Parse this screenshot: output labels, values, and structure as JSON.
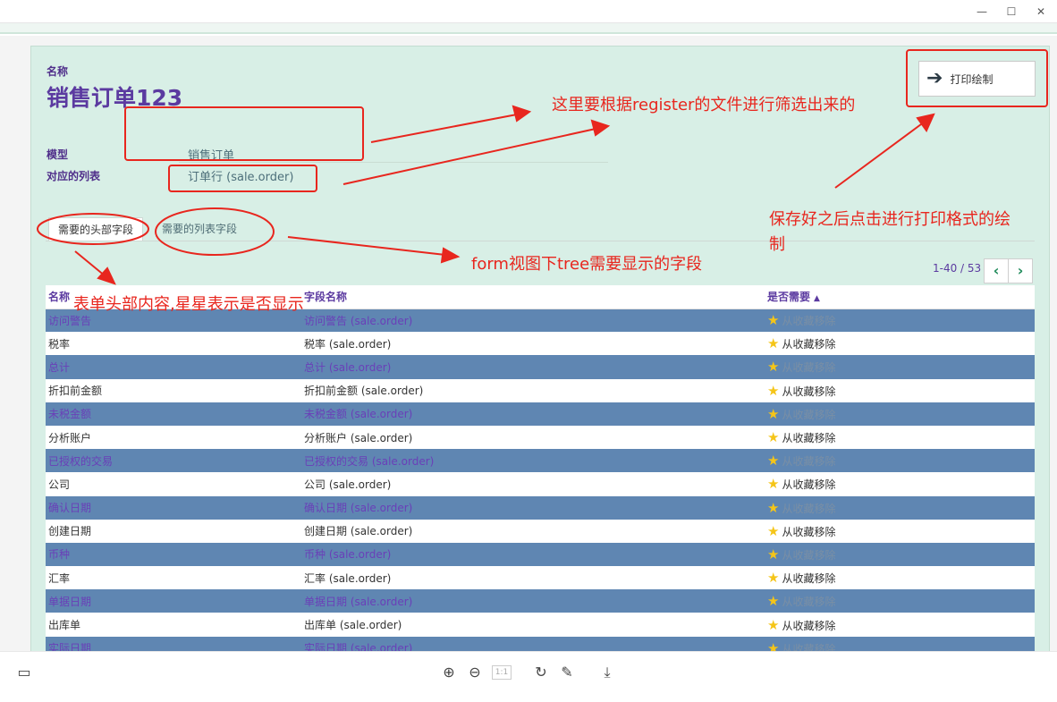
{
  "window": {
    "minimize": "—",
    "maximize": "☐",
    "close": "✕"
  },
  "form": {
    "name_label": "名称",
    "title": "销售订单123",
    "model_label": "模型",
    "model_value": "销售订单",
    "list_label": "对应的列表",
    "list_value": "订单行 (sale.order)",
    "print_button": "打印绘制"
  },
  "tabs": [
    {
      "label": "需要的头部字段",
      "active": true
    },
    {
      "label": "需要的列表字段",
      "active": false
    }
  ],
  "pager": {
    "range": "1-40 / 53"
  },
  "table": {
    "headers": [
      "名称",
      "字段名称",
      "是否需要"
    ],
    "rows": [
      {
        "name": "访问警告",
        "field": "访问警告 (sale.order)",
        "status": "从收藏移除"
      },
      {
        "name": "税率",
        "field": "税率 (sale.order)",
        "status": "从收藏移除"
      },
      {
        "name": "总计",
        "field": "总计 (sale.order)",
        "status": "从收藏移除"
      },
      {
        "name": "折扣前金额",
        "field": "折扣前金额 (sale.order)",
        "status": "从收藏移除"
      },
      {
        "name": "未税金额",
        "field": "未税金额 (sale.order)",
        "status": "从收藏移除"
      },
      {
        "name": "分析账户",
        "field": "分析账户 (sale.order)",
        "status": "从收藏移除"
      },
      {
        "name": "已授权的交易",
        "field": "已授权的交易 (sale.order)",
        "status": "从收藏移除"
      },
      {
        "name": "公司",
        "field": "公司 (sale.order)",
        "status": "从收藏移除"
      },
      {
        "name": "确认日期",
        "field": "确认日期 (sale.order)",
        "status": "从收藏移除"
      },
      {
        "name": "创建日期",
        "field": "创建日期 (sale.order)",
        "status": "从收藏移除"
      },
      {
        "name": "币种",
        "field": "币种 (sale.order)",
        "status": "从收藏移除"
      },
      {
        "name": "汇率",
        "field": "汇率 (sale.order)",
        "status": "从收藏移除"
      },
      {
        "name": "单据日期",
        "field": "单据日期 (sale.order)",
        "status": "从收藏移除"
      },
      {
        "name": "出库单",
        "field": "出库单 (sale.order)",
        "status": "从收藏移除"
      },
      {
        "name": "实际日期",
        "field": "实际日期 (sale.order)",
        "status": "从收藏移除"
      }
    ]
  },
  "annotations": {
    "a1": "这里要根据register的文件进行筛选出来的",
    "a2": "保存好之后点击进行打印格式的绘",
    "a2b": "制",
    "a3": "form视图下tree需要显示的字段",
    "a4": "表单头部内容,星星表示是否显示"
  },
  "toolbar": {
    "zoom_reset": "1:1"
  },
  "colors": {
    "annotation": "#e8261e",
    "accent": "#5b3aa0",
    "row_band": "#5f86b2",
    "sheet_bg": "#d8efe6"
  },
  "icons": [
    "layout-icon",
    "zoom-in-icon",
    "zoom-out-icon",
    "actual-size-icon",
    "rotate-icon",
    "edit-icon",
    "download-icon",
    "star-icon",
    "arrow-right-icon",
    "chevron-left-icon",
    "chevron-right-icon"
  ]
}
